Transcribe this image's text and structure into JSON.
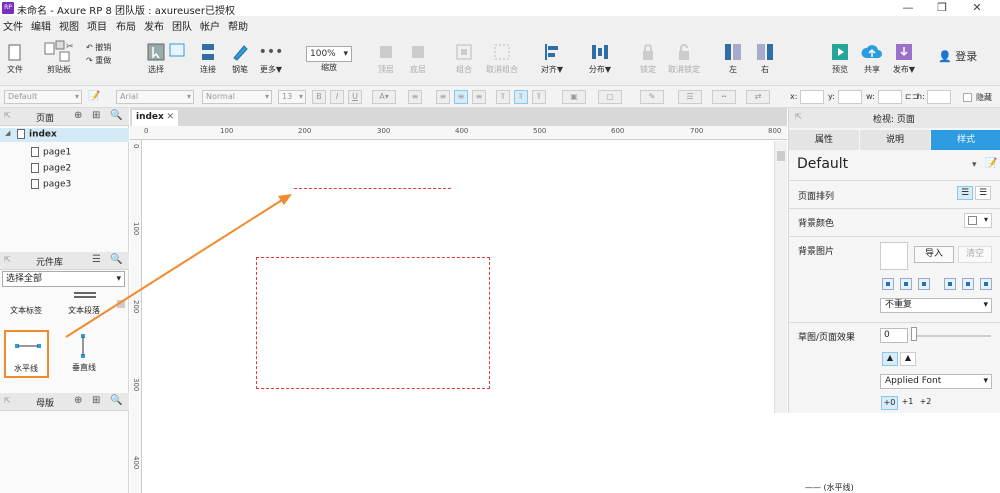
{
  "window": {
    "title": "未命名 - Axure RP 8 团队版 : axureuser已授权",
    "app_icon": "RP"
  },
  "menu": [
    "文件",
    "编辑",
    "视图",
    "项目",
    "布局",
    "发布",
    "团队",
    "帐户",
    "帮助"
  ],
  "toolbar": {
    "file": "文件",
    "clipboard": "剪贴板",
    "undo": "撤销",
    "redo": "重做",
    "select": "选择",
    "connect": "连接",
    "pen": "钢笔",
    "more": "更多▼",
    "zoom_value": "100%",
    "zoom": "缩放",
    "top": "顶层",
    "bottom": "底层",
    "group": "组合",
    "ungroup": "取消组合",
    "align": "对齐▼",
    "distribute": "分布▼",
    "lock": "锁定",
    "unlock": "取消锁定",
    "left": "左",
    "right": "右",
    "preview": "预览",
    "share": "共享",
    "publish": "发布▼",
    "login": "登录"
  },
  "format_bar": {
    "style": "Default",
    "font": "Arial",
    "weight": "Normal",
    "size": "13",
    "x_label": "x:",
    "y_label": "y:",
    "w_label": "w:",
    "h_label": "h:",
    "hidden": "隐藏"
  },
  "pages_panel": {
    "title": "页面",
    "items": [
      {
        "label": "index",
        "level": 0,
        "selected": true
      },
      {
        "label": "page1",
        "level": 1
      },
      {
        "label": "page2",
        "level": 1
      },
      {
        "label": "page3",
        "level": 1
      }
    ]
  },
  "library_panel": {
    "title": "元件库",
    "filter": "选择全部",
    "items_top": [
      "文本标签",
      "文本段落"
    ],
    "items": [
      {
        "label": "水平线",
        "highlighted": true
      },
      {
        "label": "垂直线"
      }
    ]
  },
  "masters_panel": {
    "title": "母版"
  },
  "canvas": {
    "tab": "index",
    "h_ticks": [
      "0",
      "100",
      "200",
      "300",
      "400",
      "500",
      "600",
      "700",
      "800"
    ],
    "v_ticks": [
      "0",
      "100",
      "200",
      "300",
      "400"
    ]
  },
  "inspector": {
    "header": "检视: 页面",
    "tabs": [
      "属性",
      "说明",
      "样式"
    ],
    "active_tab": "样式",
    "style_name": "Default",
    "page_align": "页面排列",
    "bg_color": "背景颜色",
    "bg_image": "背景图片",
    "import": "导入",
    "clear": "清空",
    "repeat": "不重复",
    "sketch": "草图/页面效果",
    "sketch_value": "0",
    "font": "Applied Font",
    "font_steps": [
      "+0",
      "+1",
      "+2"
    ],
    "footer_item": "—— (水平线)"
  },
  "colors": {
    "accent": "#2d9be0",
    "arrow": "#f08a2c",
    "dashed": "#e53935"
  }
}
